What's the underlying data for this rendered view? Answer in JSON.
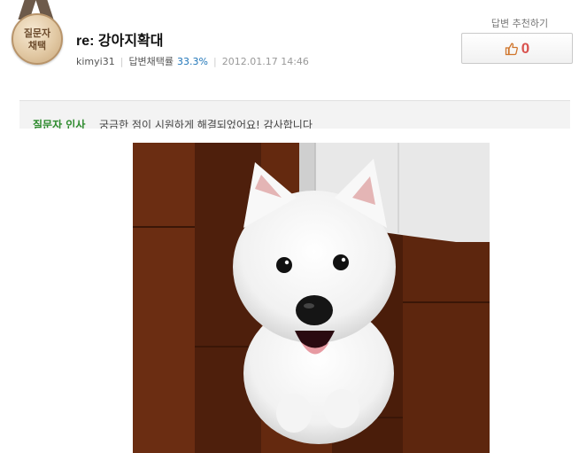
{
  "medal": {
    "icon": "medal-icon",
    "text_line1": "질문자",
    "text_line2": "채택"
  },
  "answer": {
    "title": "re: 강아지확대",
    "author": "kimyi31",
    "rate_label": "답변채택률",
    "rate_value": "33.3%",
    "date": "2012.01.17 14:46"
  },
  "recommend": {
    "label": "답변 추천하기",
    "icon": "thumbs-up-icon",
    "count": "0"
  },
  "comment": {
    "label": "질문자 인사",
    "text": "궁금한 점이 시원하게 해결되었어요! 감사합니다"
  },
  "photo": {
    "subject": "white-puppy-photo"
  },
  "colors": {
    "accent_red": "#d9534f",
    "rate_blue": "#1f75b8",
    "comment_green": "#2e8b2e",
    "floor_brown": "#5a240f"
  }
}
